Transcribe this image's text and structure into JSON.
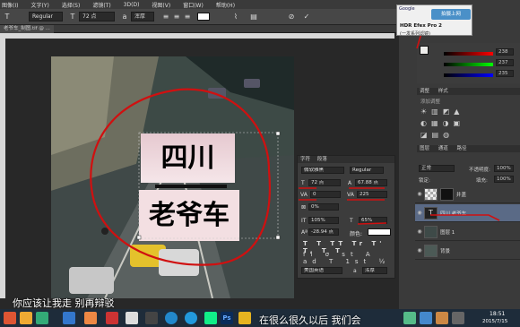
{
  "menubar": {
    "items": [
      "图像(I)",
      "文字(Y)",
      "选择(S)",
      "滤镜(T)",
      "3D(D)",
      "视图(V)",
      "窗口(W)",
      "帮助(H)"
    ]
  },
  "options": {
    "font_style": "Regular",
    "font_size": "72 点",
    "aa": "浑厚",
    "text_color": "#ffffff"
  },
  "document": {
    "tab_title": "老爷车_制图.tif @ ..."
  },
  "canvas": {
    "line1": "四川",
    "line2": "老爷车"
  },
  "popup": {
    "title": "Google",
    "btn": "拍摄上网",
    "app": "HDR Efex Pro 2",
    "sub": "(一发系列滤镜)"
  },
  "color_panel": {
    "values": [
      "238",
      "237",
      "235"
    ]
  },
  "adjust_panel": {
    "tabs": [
      "调整",
      "样式"
    ],
    "hint": "添加调整"
  },
  "char_panel": {
    "tabs": [
      "字符",
      "段落"
    ],
    "font_family": "微软雅黑",
    "font_style": "Regular",
    "size": "72 点",
    "leading": "67.88 点",
    "kerning": "0",
    "tracking": "225",
    "scale_v": "0%",
    "vscale": "105%",
    "hscale": "65%",
    "baseline": "-28.94 点",
    "color_label": "颜色:",
    "language": "美国英语",
    "aa": "浑厚"
  },
  "layers_panel": {
    "tabs": [
      "图层",
      "通道",
      "路径"
    ],
    "blend": "正常",
    "opacity_label": "不透明度:",
    "opacity": "100%",
    "lock_label": "锁定:",
    "fill_label": "填充:",
    "fill": "100%",
    "layers": [
      {
        "name": "井盖",
        "icon": "mask"
      },
      {
        "name": "四川 老爷车",
        "icon": "T"
      },
      {
        "name": "图层 1",
        "icon": "img"
      },
      {
        "name": "背景",
        "icon": "img"
      }
    ]
  },
  "subtitles": {
    "main": "你应该让我走 别再辩驳",
    "overlay": "在很么很久以后 我们会"
  },
  "taskbar": {
    "time": "18:51",
    "date": "2015/7/15"
  }
}
